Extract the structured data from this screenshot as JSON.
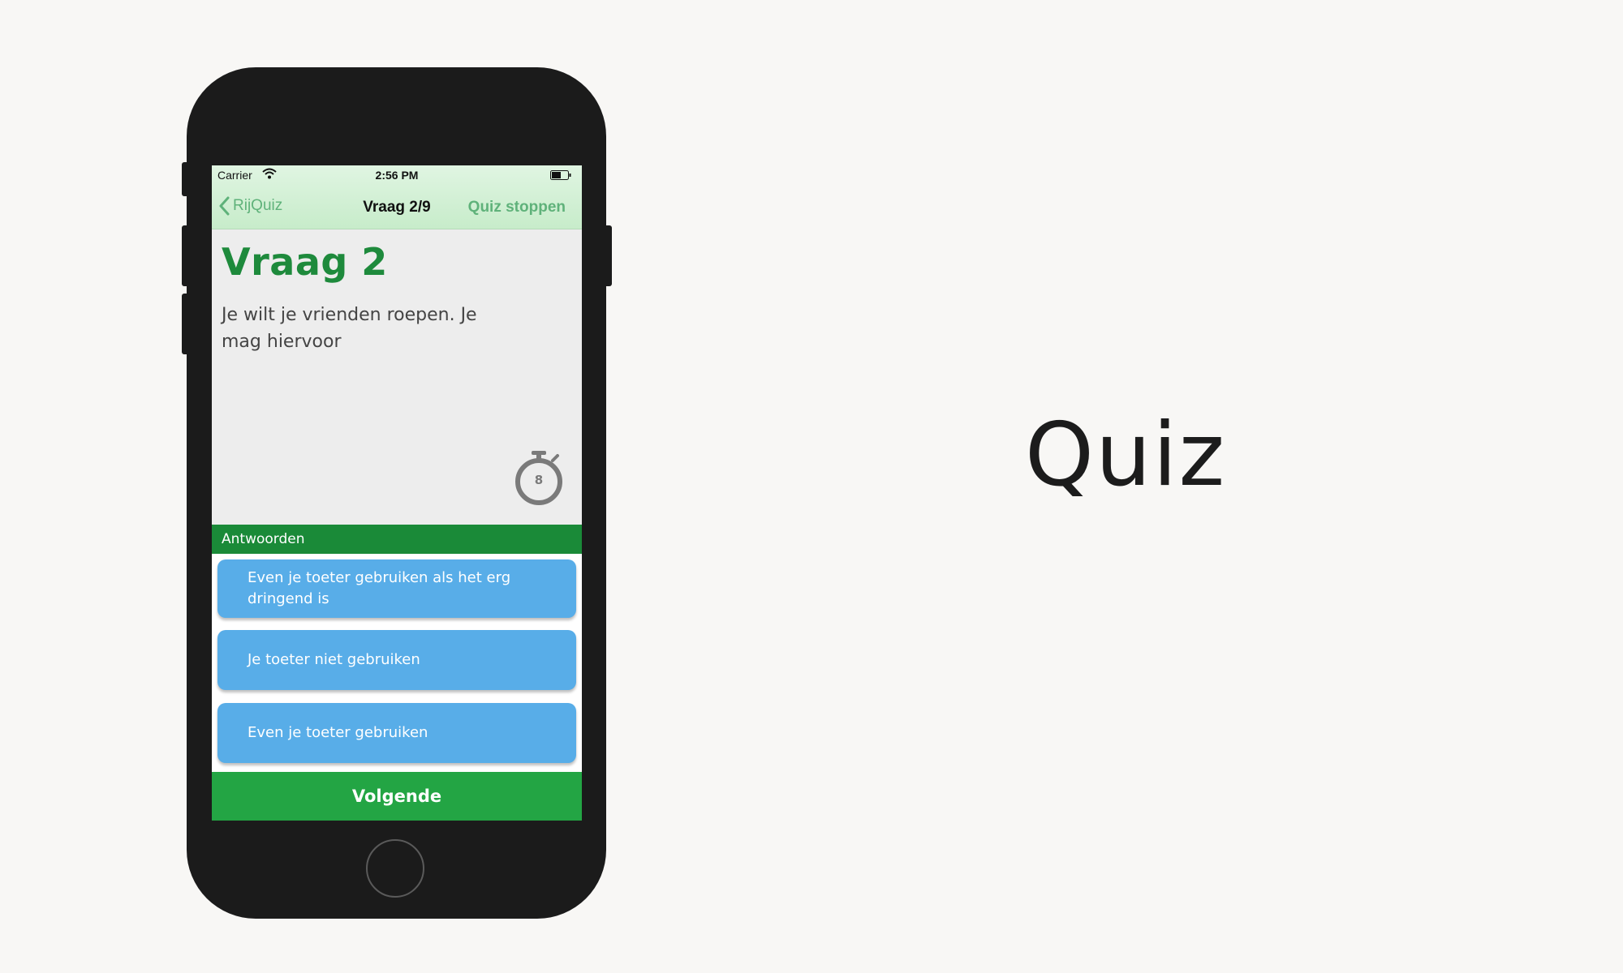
{
  "status_bar": {
    "carrier": "Carrier",
    "time": "2:56 PM",
    "wifi_icon": "wifi-icon",
    "battery_icon": "battery-icon"
  },
  "nav": {
    "back_label": "RijQuiz",
    "title": "Vraag 2/9",
    "stop_label": "Quiz stoppen"
  },
  "question": {
    "title": "Vraag 2",
    "text": "Je wilt je vrienden roepen. Je mag hiervoor",
    "timer_seconds": "8"
  },
  "answers": {
    "header": "Antwoorden",
    "items": [
      {
        "label": "Even je toeter gebruiken als het erg dringend is"
      },
      {
        "label": "Je toeter niet gebruiken"
      },
      {
        "label": "Even je toeter gebruiken"
      }
    ]
  },
  "footer": {
    "next_label": "Volgende"
  },
  "caption": "Quiz",
  "colors": {
    "accent_green": "#1e8a3c",
    "button_green": "#23a544",
    "answer_blue": "#58ade8",
    "nav_tint": "#5fb27a"
  }
}
